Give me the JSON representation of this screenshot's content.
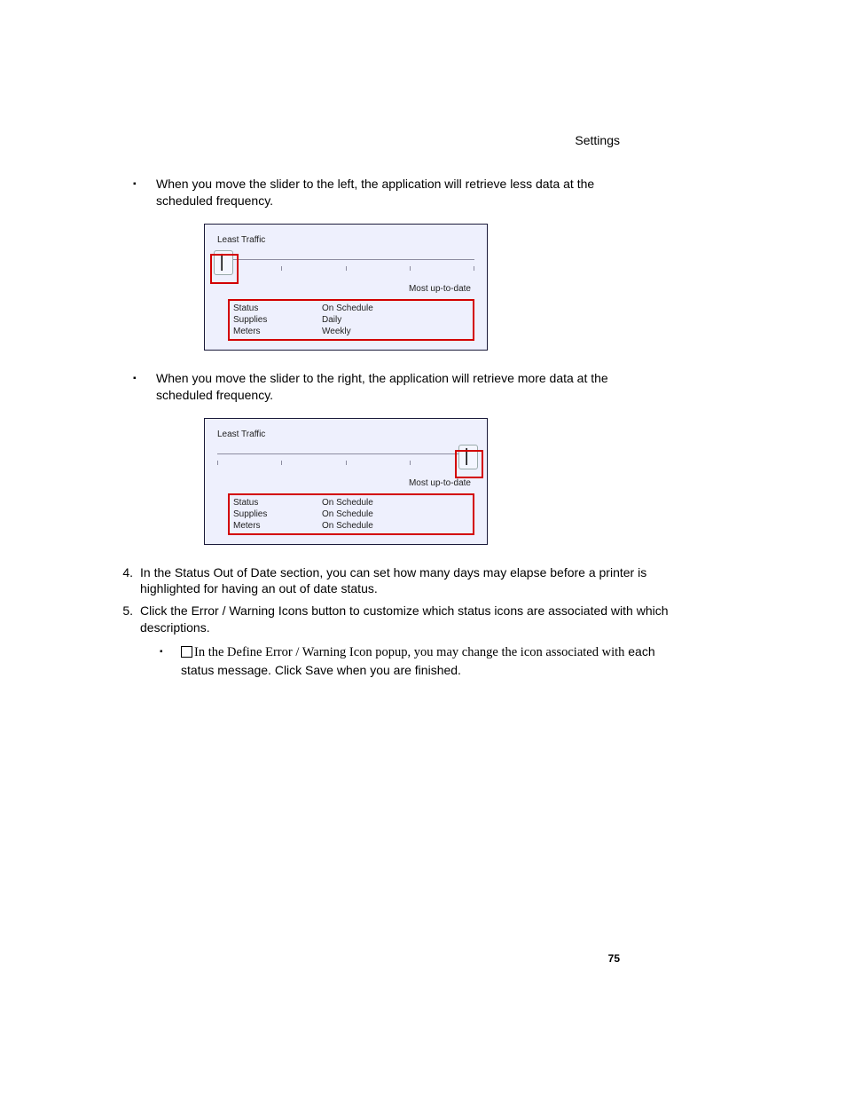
{
  "header": {
    "section": "Settings"
  },
  "page_number": "75",
  "bullets": {
    "b1": "When you move the slider to the left, the application will retrieve less data at the scheduled frequency.",
    "b2": "When you move the slider to the right, the application will retrieve more data at the scheduled frequency."
  },
  "steps": {
    "n4_marker": "4.",
    "n4": "In the Status Out of Date section, you can set how many days may elapse before a printer is highlighted for having an out of date status.",
    "n5_marker": "5.",
    "n5": "Click the Error / Warning Icons button to customize which status icons are associated with which descriptions.",
    "sub_a": "In the Define Error / Warning Icon popup, you may change the icon associated with",
    "sub_b": "each status message. Click Save when you are finished."
  },
  "widget": {
    "least": "Least Traffic",
    "most": "Most up-to-date",
    "rows_left": [
      {
        "label": "Status",
        "value": "On Schedule"
      },
      {
        "label": "Supplies",
        "value": "Daily"
      },
      {
        "label": "Meters",
        "value": "Weekly"
      }
    ],
    "rows_right": [
      {
        "label": "Status",
        "value": "On Schedule"
      },
      {
        "label": "Supplies",
        "value": "On Schedule"
      },
      {
        "label": "Meters",
        "value": "On Schedule"
      }
    ]
  }
}
